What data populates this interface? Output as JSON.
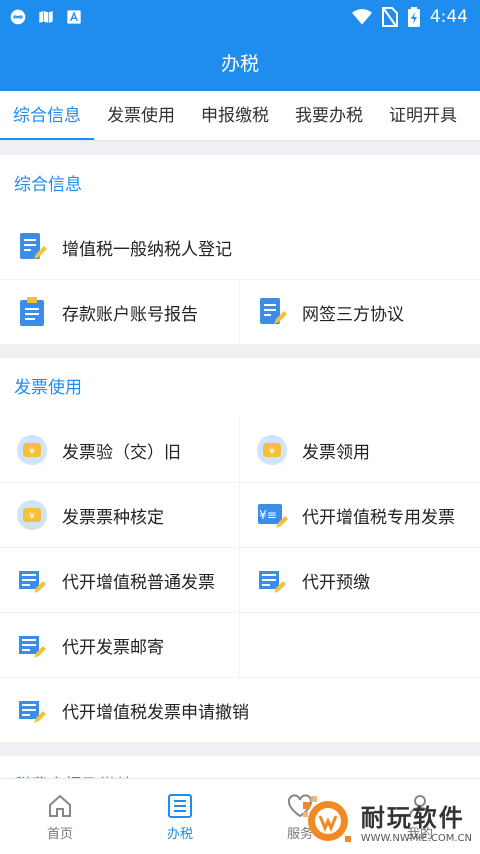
{
  "status_bar": {
    "time": "4:44",
    "icons": [
      "infinity-icon",
      "book-icon",
      "a-icon",
      "wifi-icon",
      "no-sim-icon",
      "battery-icon"
    ]
  },
  "header": {
    "title": "办税"
  },
  "tabs": [
    {
      "label": "综合信息",
      "active": true
    },
    {
      "label": "发票使用",
      "active": false
    },
    {
      "label": "申报缴税",
      "active": false
    },
    {
      "label": "我要办税",
      "active": false
    },
    {
      "label": "证明开具",
      "active": false
    }
  ],
  "sections": [
    {
      "title": "综合信息",
      "items": [
        {
          "label": "增值税一般纳税人登记",
          "icon": "document-edit-icon"
        },
        {
          "label": "存款账户账号报告",
          "icon": "clipboard-icon"
        },
        {
          "label": "网签三方协议",
          "icon": "document-edit-icon"
        }
      ]
    },
    {
      "title": "发票使用",
      "items": [
        {
          "label": "发票验（交）旧",
          "icon": "invoice-ticket-icon"
        },
        {
          "label": "发票领用",
          "icon": "invoice-ticket-icon"
        },
        {
          "label": "发票票种核定",
          "icon": "invoice-ticket-icon"
        },
        {
          "label": "代开增值税专用发票",
          "icon": "yuan-edit-icon"
        },
        {
          "label": "代开增值税普通发票",
          "icon": "list-edit-icon"
        },
        {
          "label": "代开预缴",
          "icon": "list-edit-icon"
        },
        {
          "label": "代开发票邮寄",
          "icon": "list-edit-icon"
        },
        {
          "label": "代开增值税发票申请撤销",
          "icon": "list-edit-icon"
        }
      ]
    },
    {
      "title": "税费申报及缴纳",
      "items": []
    }
  ],
  "bottom_nav": [
    {
      "label": "首页",
      "icon": "home-icon",
      "active": false
    },
    {
      "label": "办税",
      "icon": "tax-list-icon",
      "active": true
    },
    {
      "label": "服务",
      "icon": "service-icon",
      "active": false
    },
    {
      "label": "我的",
      "icon": "profile-icon",
      "active": false
    }
  ],
  "watermark": {
    "brand": "耐玩软件",
    "url": "WWW.NWMIE.COM.CN"
  },
  "colors": {
    "primary": "#1f8ded",
    "icon_yellow": "#f5c13a",
    "icon_blue": "#3b8de8",
    "page_bg": "#eef0f3"
  }
}
